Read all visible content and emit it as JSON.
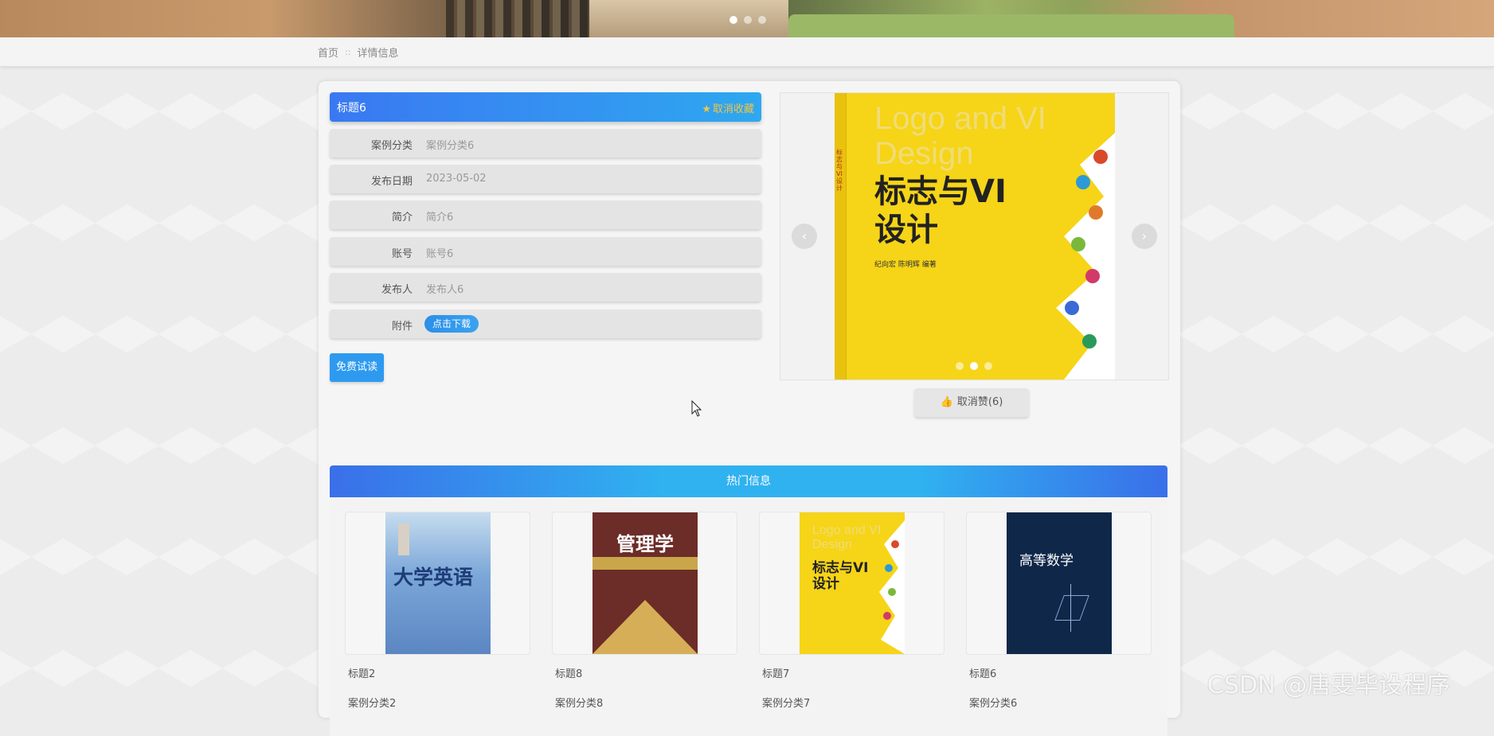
{
  "banner": {
    "dots": 3,
    "active_dot": 0
  },
  "breadcrumb": {
    "home": "首页",
    "separator": "::",
    "current": "详情信息"
  },
  "detail": {
    "title": "标题6",
    "favorite_label": "取消收藏",
    "fields": [
      {
        "label": "案例分类",
        "value": "案例分类6"
      },
      {
        "label": "发布日期",
        "value": "2023-05-02"
      },
      {
        "label": "简介",
        "value": "简介6"
      },
      {
        "label": "账号",
        "value": "账号6"
      },
      {
        "label": "发布人",
        "value": "发布人6"
      },
      {
        "label": "附件",
        "button": "点击下载"
      }
    ],
    "trial_button": "免费试读"
  },
  "carousel": {
    "cover_title_en": "Logo and VI Design",
    "cover_title_cn": "标志与VI设计",
    "cover_spine": "标志与VI设计",
    "cover_authors": "纪向宏 陈明辉 编著",
    "prev_icon": "chevron-left-icon",
    "next_icon": "chevron-right-icon",
    "dots": 3,
    "active_dot": 1
  },
  "like": {
    "label": "取消赞(6)",
    "icon": "thumbs-up-icon"
  },
  "hot": {
    "header": "热门信息",
    "items": [
      {
        "title": "标题2",
        "category": "案例分类2",
        "cover_text": "大学英语"
      },
      {
        "title": "标题8",
        "category": "案例分类8",
        "cover_text": "管理学"
      },
      {
        "title": "标题7",
        "category": "案例分类7",
        "cover_text": "标志与VI设计"
      },
      {
        "title": "标题6",
        "category": "案例分类6",
        "cover_text": "高等数学"
      }
    ]
  },
  "watermark": "CSDN @唐雯毕设程序",
  "colors": {
    "primary_blue": "#2d9af0",
    "gradient_start": "#3a78f2",
    "gradient_end": "#2ea8f0",
    "favorite_gold": "#f4c542"
  }
}
